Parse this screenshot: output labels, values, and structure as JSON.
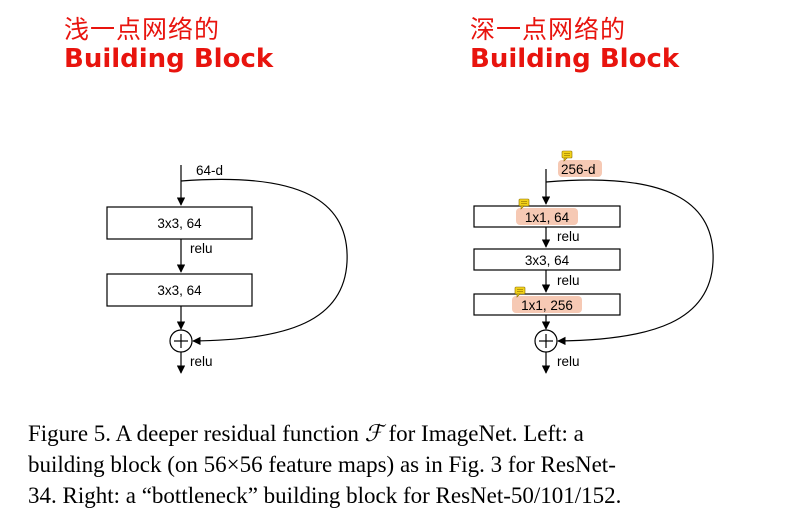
{
  "headings": {
    "left": {
      "cn": "浅一点网络的",
      "en": "Building Block"
    },
    "right": {
      "cn": "深一点网络的",
      "en": "Building Block"
    }
  },
  "left_block": {
    "input": "64-d",
    "layers": [
      "3x3, 64",
      "3x3, 64"
    ],
    "activations": [
      "relu",
      "relu"
    ]
  },
  "right_block": {
    "input": "256-d",
    "layers": [
      "1x1, 64",
      "3x3, 64",
      "1x1, 256"
    ],
    "activations": [
      "relu",
      "relu",
      "relu"
    ]
  },
  "caption": {
    "line1_a": "Figure 5. A deeper residual function ",
    "script_f": "ℱ",
    "line1_b": " for ImageNet.  Left: a",
    "line2": "building block (on 56×56 feature maps) as in Fig. 3 for ResNet-",
    "line3": "34. Right: a “bottleneck” building block for ResNet-50/101/152."
  }
}
